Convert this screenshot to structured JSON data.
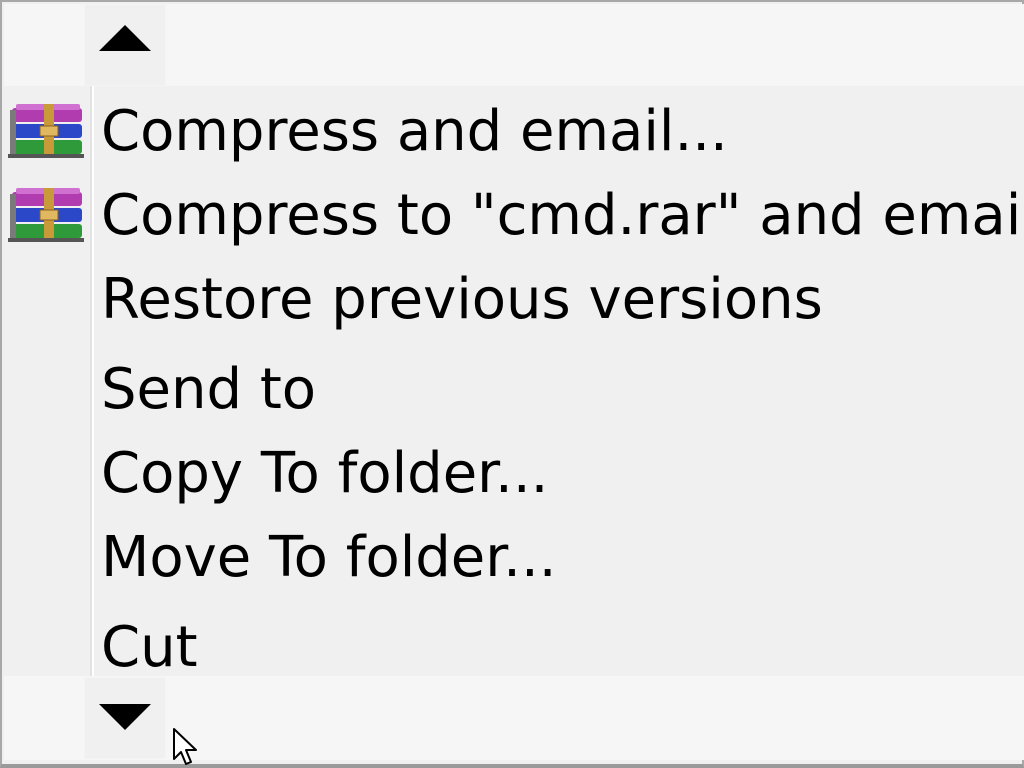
{
  "menu": {
    "scroll_up_icon": "triangle-up-icon",
    "scroll_down_icon": "triangle-down-icon",
    "items": [
      {
        "label": "Compress and email...",
        "icon": "winrar-archive-icon"
      },
      {
        "label": "Compress to \"cmd.rar\" and email",
        "icon": "winrar-archive-icon"
      },
      {
        "label": "Restore previous versions",
        "icon": ""
      },
      {
        "label": "Send to",
        "icon": ""
      },
      {
        "label": "Copy To folder...",
        "icon": ""
      },
      {
        "label": "Move To folder...",
        "icon": ""
      },
      {
        "label": "Cut",
        "icon": ""
      }
    ]
  },
  "colors": {
    "menu_background": "#f0f0f0",
    "text": "#000000",
    "winrar_purple": "#b03cb0",
    "winrar_blue": "#2b48c8",
    "winrar_green": "#2f9a3a",
    "winrar_strap": "#c89a3a"
  },
  "cursor": {
    "icon": "mouse-pointer-icon"
  }
}
